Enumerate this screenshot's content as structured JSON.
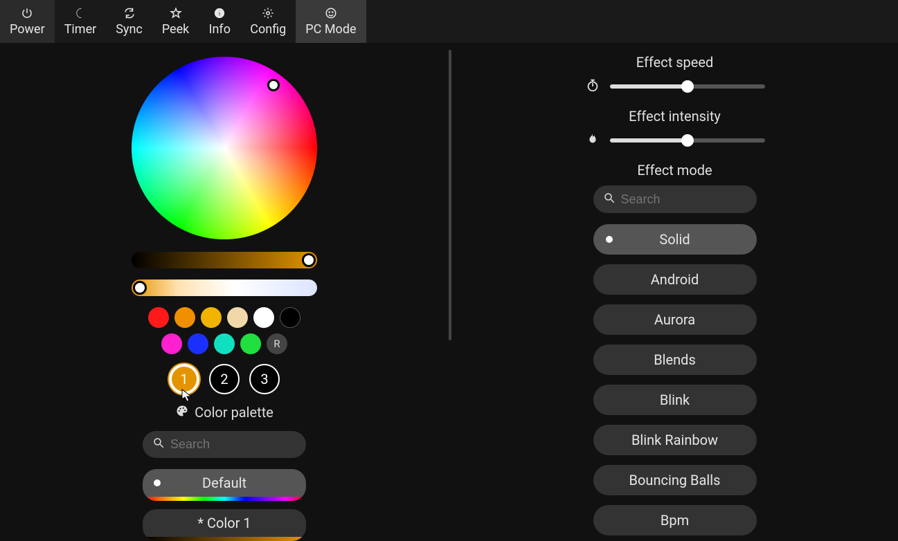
{
  "toolbar": {
    "power": "Power",
    "timer": "Timer",
    "sync": "Sync",
    "peek": "Peek",
    "info": "Info",
    "config": "Config",
    "pcmode": "PC Mode"
  },
  "color": {
    "swatches_top": [
      "#ff1a1a",
      "#f09000",
      "#f0b400",
      "#f0d8a8",
      "#ffffff",
      "#000000"
    ],
    "swatches_bottom": [
      "#ff20d0",
      "#1a30ff",
      "#10e0c0",
      "#20e040"
    ],
    "reset_label": "R",
    "slots": [
      "1",
      "2",
      "3"
    ],
    "active_slot": 0,
    "palette_header": "Color palette",
    "search_placeholder": "Search",
    "palettes": [
      {
        "label": "Default",
        "selected": true,
        "bar": "rainbow"
      },
      {
        "label": "* Color 1",
        "selected": false,
        "bar": "grad-orange"
      }
    ]
  },
  "effects": {
    "speed_label": "Effect speed",
    "speed_value": 50,
    "intensity_label": "Effect intensity",
    "intensity_value": 50,
    "mode_label": "Effect mode",
    "search_placeholder": "Search",
    "modes": [
      {
        "label": "Solid",
        "selected": true
      },
      {
        "label": "Android",
        "selected": false
      },
      {
        "label": "Aurora",
        "selected": false
      },
      {
        "label": "Blends",
        "selected": false
      },
      {
        "label": "Blink",
        "selected": false
      },
      {
        "label": "Blink Rainbow",
        "selected": false
      },
      {
        "label": "Bouncing Balls",
        "selected": false
      },
      {
        "label": "Bpm",
        "selected": false
      }
    ]
  }
}
